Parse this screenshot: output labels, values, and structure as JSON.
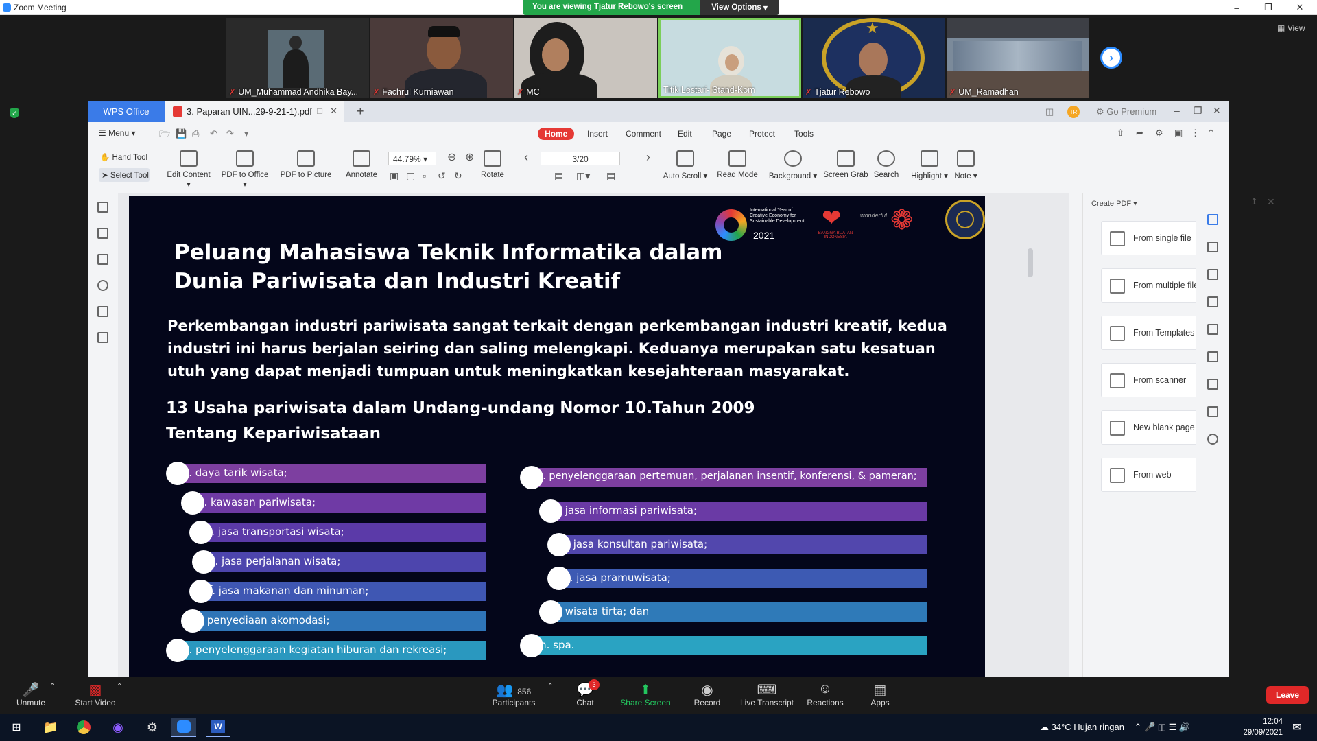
{
  "zoom": {
    "window_title": "Zoom Meeting",
    "banner_text": "You are viewing Tjatur Rebowo's screen",
    "view_options": "View Options",
    "view_label": "View",
    "participants": [
      {
        "name": "UM_Muhammad Andhika Bay..."
      },
      {
        "name": "Fachrul Kurniawan"
      },
      {
        "name": "MC"
      },
      {
        "name": "Titik Lestari- Stand-Kom"
      },
      {
        "name": "Tjatur Rebowo"
      },
      {
        "name": "UM_Ramadhan"
      }
    ],
    "controls": {
      "unmute": "Unmute",
      "start_video": "Start Video",
      "participants": "Participants",
      "participant_count": "856",
      "chat": "Chat",
      "chat_badge": "3",
      "share_screen": "Share Screen",
      "record": "Record",
      "live_transcript": "Live Transcript",
      "reactions": "Reactions",
      "apps": "Apps",
      "leave": "Leave"
    }
  },
  "wps": {
    "app_tab": "WPS Office",
    "doc_tab": "3. Paparan UIN...29-9-21-1).pdf",
    "go_premium": "Go Premium",
    "avatar_initials": "TR",
    "menu": "Menu",
    "ribbon_tabs": [
      "Home",
      "Insert",
      "Comment",
      "Edit",
      "Page",
      "Protect",
      "Tools"
    ],
    "tools": {
      "hand_tool": "Hand Tool",
      "select_tool": "Select Tool",
      "edit_content": "Edit Content",
      "pdf_to_office": "PDF to Office",
      "pdf_to_picture": "PDF to Picture",
      "annotate": "Annotate",
      "zoom": "44.79%",
      "rotate": "Rotate",
      "page": "3/20",
      "auto_scroll": "Auto Scroll",
      "read_mode": "Read Mode",
      "background": "Background",
      "screen_grab": "Screen Grab",
      "search": "Search",
      "highlight": "Highlight",
      "note": "Note"
    },
    "right_panel": {
      "header": "Create PDF",
      "items": [
        "From single file",
        "From multiple files",
        "From Templates",
        "From scanner",
        "New blank page",
        "From web"
      ]
    }
  },
  "slide": {
    "title_line1": "Peluang Mahasiswa Teknik Informatika dalam",
    "title_line2": "Dunia Pariwisata dan Industri Kreatif",
    "paragraph": "Perkembangan industri pariwisata sangat terkait dengan perkembangan industri kreatif, kedua industri ini harus berjalan seiring dan saling melengkapi. Keduanya merupakan satu kesatuan utuh yang dapat menjadi tumpuan untuk meningkatkan kesejahteraan masyarakat.",
    "subtitle_line1": "13 Usaha pariwisata dalam Undang-undang Nomor 10.Tahun 2009",
    "subtitle_line2": "Tentang Kepariwisataan",
    "logo_text": "International Year of Creative Economy for Sustainable Development",
    "logo_year": "2021",
    "logo_heart_text": "BANGGA BUATAN INDONESIA",
    "logo_wonderful": "wonderful",
    "left_items": [
      "a. daya tarik wisata;",
      "b. kawasan pariwisata;",
      "c. jasa transportasi wisata;",
      "d. jasa perjalanan wisata;",
      "e. jasa makanan dan minuman;",
      "f. penyediaan akomodasi;",
      "g. penyelenggaraan kegiatan hiburan dan rekreasi;"
    ],
    "right_items": [
      "h. penyelenggaraan pertemuan, perjalanan insentif, konferensi, & pameran;",
      "i. jasa informasi pariwisata;",
      "j. jasa konsultan pariwisata;",
      "k. jasa pramuwisata;",
      "l. wisata tirta; dan",
      "m. spa."
    ]
  },
  "taskbar": {
    "weather": "34°C  Hujan ringan",
    "time": "12:04",
    "date": "29/09/2021"
  },
  "colors": {
    "zoom_blue": "#2d8cff",
    "banner_green": "#23a64a",
    "wps_blue": "#3a7be8",
    "home_red": "#e53935",
    "leave_red": "#e02828"
  }
}
